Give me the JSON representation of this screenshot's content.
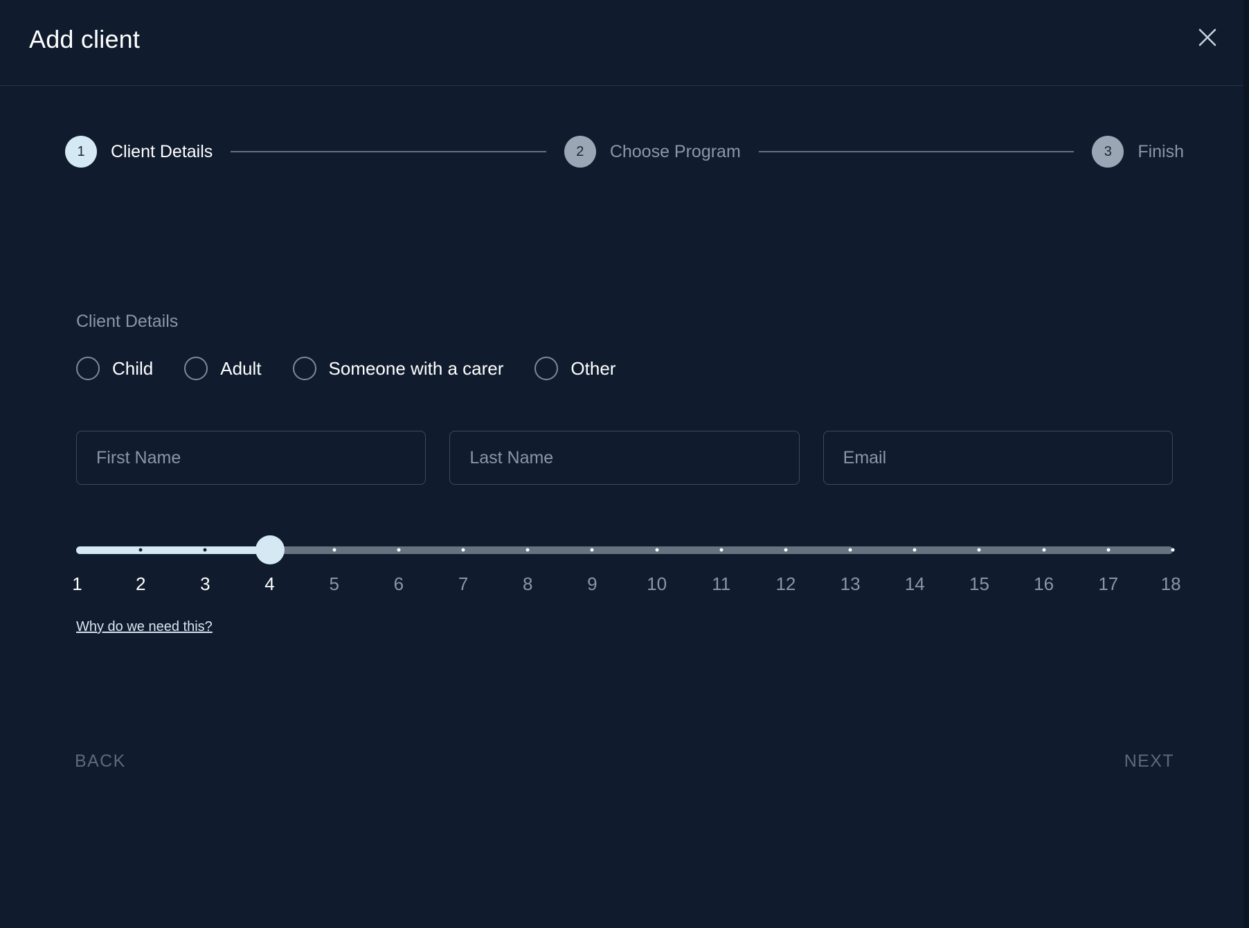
{
  "header": {
    "title": "Add client",
    "close_icon": "close-icon"
  },
  "stepper": {
    "steps": [
      {
        "number": "1",
        "label": "Client Details",
        "state": "active"
      },
      {
        "number": "2",
        "label": "Choose Program",
        "state": "inactive"
      },
      {
        "number": "3",
        "label": "Finish",
        "state": "inactive"
      }
    ]
  },
  "form": {
    "section_label": "Client Details",
    "client_type": {
      "selected": null,
      "options": [
        {
          "label": "Child",
          "checked": false
        },
        {
          "label": "Adult",
          "checked": false
        },
        {
          "label": "Someone with a carer",
          "checked": false
        },
        {
          "label": "Other",
          "checked": false
        }
      ]
    },
    "fields": [
      {
        "name": "first-name",
        "placeholder": "First Name",
        "value": ""
      },
      {
        "name": "last-name",
        "placeholder": "Last Name",
        "value": ""
      },
      {
        "name": "email",
        "placeholder": "Email",
        "value": ""
      }
    ],
    "age_slider": {
      "min": 1,
      "max": 18,
      "value": 4,
      "ticks": [
        "1",
        "2",
        "3",
        "4",
        "5",
        "6",
        "7",
        "8",
        "9",
        "10",
        "11",
        "12",
        "13",
        "14",
        "15",
        "16",
        "17",
        "18"
      ]
    },
    "help_link": "Why do we need this?"
  },
  "footer": {
    "back_label": "BACK",
    "next_label": "NEXT"
  },
  "colors": {
    "background": "#101c2e",
    "accent": "#d5e9f5",
    "muted": "#8b97a6",
    "rail": "#67717f",
    "border": "#3b4a5e",
    "divider": "#223349",
    "footer_text": "#5c6a7c"
  }
}
